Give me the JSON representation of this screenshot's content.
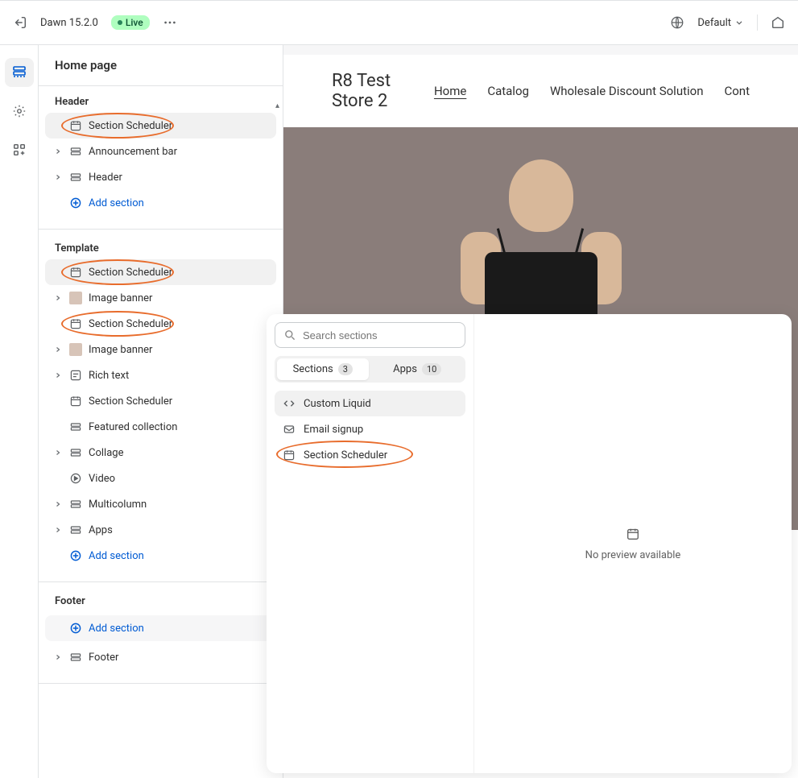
{
  "topbar": {
    "theme_name": "Dawn 15.2.0",
    "live_label": "Live",
    "default_label": "Default"
  },
  "sidebar": {
    "page_title": "Home page",
    "groups": [
      {
        "name": "Header",
        "items": [
          {
            "label": "Section Scheduler",
            "icon": "scheduler",
            "selected": true,
            "highlighted": true,
            "expandable": false
          },
          {
            "label": "Announcement bar",
            "icon": "section",
            "expandable": true
          },
          {
            "label": "Header",
            "icon": "section",
            "expandable": true
          }
        ],
        "add_label": "Add section",
        "add_style": "plain"
      },
      {
        "name": "Template",
        "items": [
          {
            "label": "Section Scheduler",
            "icon": "scheduler",
            "selected": true,
            "highlighted": true,
            "expandable": false
          },
          {
            "label": "Image banner",
            "icon": "thumb",
            "expandable": true
          },
          {
            "label": "Section Scheduler",
            "icon": "scheduler",
            "highlighted": true,
            "expandable": false
          },
          {
            "label": "Image banner",
            "icon": "thumb",
            "expandable": true
          },
          {
            "label": "Rich text",
            "icon": "richtext",
            "expandable": true
          },
          {
            "label": "Section Scheduler",
            "icon": "scheduler",
            "expandable": false
          },
          {
            "label": "Featured collection",
            "icon": "section",
            "expandable": false
          },
          {
            "label": "Collage",
            "icon": "section",
            "expandable": true
          },
          {
            "label": "Video",
            "icon": "video",
            "expandable": false
          },
          {
            "label": "Multicolumn",
            "icon": "section",
            "expandable": true
          },
          {
            "label": "Apps",
            "icon": "section",
            "expandable": true
          }
        ],
        "add_label": "Add section",
        "add_style": "plain"
      },
      {
        "name": "Footer",
        "items": [
          {
            "label": "Footer",
            "icon": "section",
            "expandable": true
          }
        ],
        "add_label": "Add section",
        "add_style": "boxed",
        "add_first": true
      }
    ]
  },
  "preview": {
    "store_name": "R8 Test Store 2",
    "nav": [
      "Home",
      "Catalog",
      "Wholesale Discount Solution",
      "Cont"
    ],
    "active_nav": 0
  },
  "popup": {
    "search_placeholder": "Search sections",
    "tabs": [
      {
        "label": "Sections",
        "count": "3",
        "active": true
      },
      {
        "label": "Apps",
        "count": "10"
      }
    ],
    "items": [
      {
        "label": "Custom Liquid",
        "icon": "code",
        "selected": true
      },
      {
        "label": "Email signup",
        "icon": "email"
      },
      {
        "label": "Section Scheduler",
        "icon": "scheduler",
        "highlighted": true
      }
    ],
    "no_preview": "No preview available"
  }
}
